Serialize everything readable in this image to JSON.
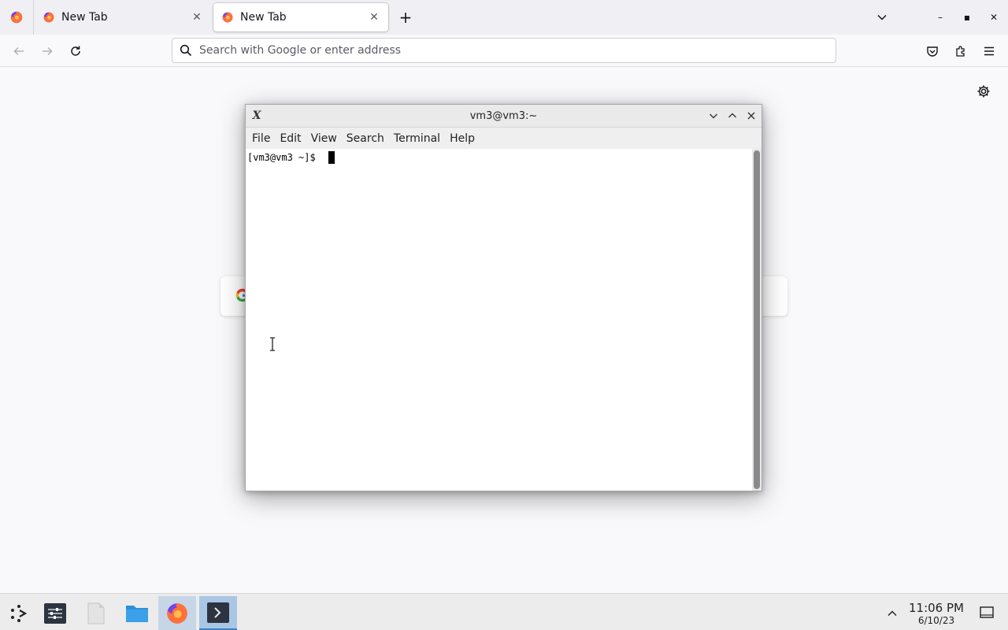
{
  "browser": {
    "tabs": [
      {
        "title": "New Tab",
        "close": "✕"
      },
      {
        "title": "New Tab",
        "close": "✕"
      }
    ],
    "new_tab": "+",
    "window_controls": {
      "minimize": "–",
      "maximize": "▪",
      "close": "✕"
    },
    "urlbar_placeholder": "Search with Google or enter address"
  },
  "terminal": {
    "title": "vm3@vm3:~",
    "menu": [
      "File",
      "Edit",
      "View",
      "Search",
      "Terminal",
      "Help"
    ],
    "prompt": "[vm3@vm3 ~]$"
  },
  "taskbar": {
    "time": "11:06 PM",
    "date": "6/10/23"
  },
  "icons": {
    "firefox": "firefox-icon",
    "search": "search-icon",
    "settings": "gear-icon",
    "pocket": "pocket-icon",
    "extensions": "extensions-icon",
    "menu": "hamburger-menu-icon"
  }
}
